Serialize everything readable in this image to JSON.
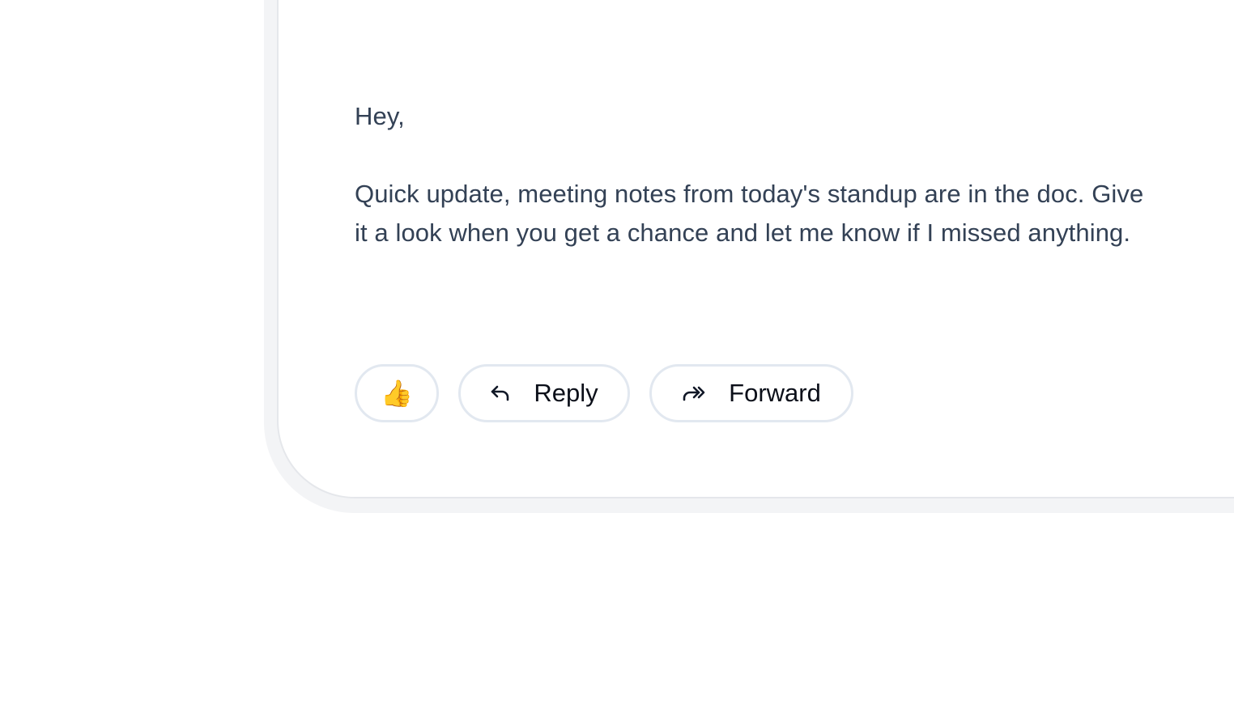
{
  "message": {
    "greeting": "Hey,",
    "body": "Quick update, meeting notes from today's standup are in the doc. Give it a look when you get a chance and let me know if I missed anything."
  },
  "actions": {
    "reaction": "👍",
    "reply_label": "Reply",
    "forward_label": "Forward"
  },
  "icons": {
    "reaction": "thumbs-up-icon",
    "reply": "reply-arrow-icon",
    "forward": "forward-arrow-icon"
  },
  "colors": {
    "body_text": "#334155",
    "button_border": "#e2e8f0",
    "card_shadow": "#f3f4f6"
  }
}
